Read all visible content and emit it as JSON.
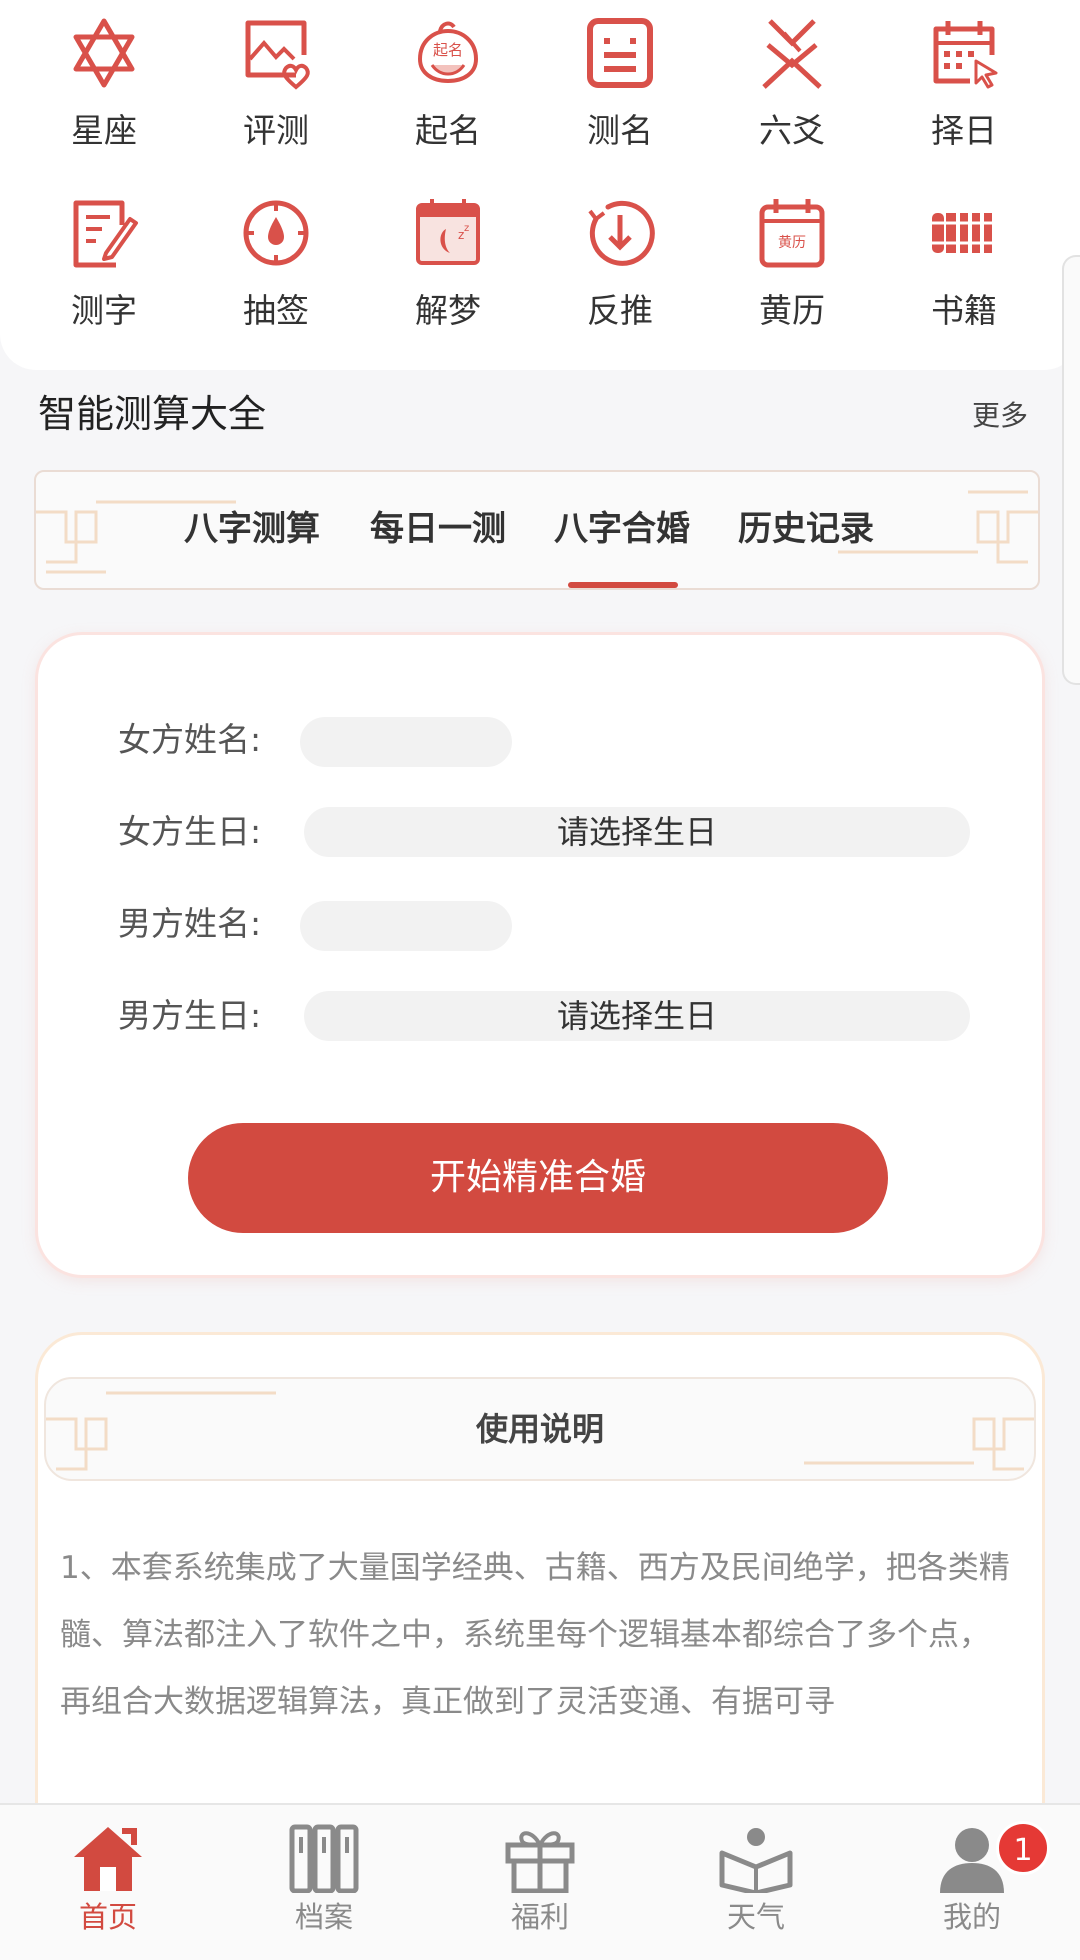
{
  "grid": [
    {
      "label": "星座",
      "icon": "star-of-david-icon"
    },
    {
      "label": "评测",
      "icon": "image-heart-icon"
    },
    {
      "label": "起名",
      "icon": "baby-naming-icon",
      "icon_text": "起名"
    },
    {
      "label": "测名",
      "icon": "document-icon"
    },
    {
      "label": "六爻",
      "icon": "hexagram-icon"
    },
    {
      "label": "择日",
      "icon": "calendar-pointer-icon"
    },
    {
      "label": "测字",
      "icon": "writing-icon"
    },
    {
      "label": "抽签",
      "icon": "compass-icon"
    },
    {
      "label": "解梦",
      "icon": "dream-calendar-icon"
    },
    {
      "label": "反推",
      "icon": "circle-down-arrow-icon"
    },
    {
      "label": "黄历",
      "icon": "almanac-calendar-icon",
      "icon_text": "黄历"
    },
    {
      "label": "书籍",
      "icon": "bamboo-scroll-icon"
    }
  ],
  "section": {
    "title": "智能测算大全",
    "more": "更多"
  },
  "tabs": [
    {
      "label": "八字测算",
      "active": false
    },
    {
      "label": "每日一测",
      "active": false
    },
    {
      "label": "八字合婚",
      "active": true
    },
    {
      "label": "历史记录",
      "active": false
    }
  ],
  "form": {
    "female_name_label": "女方姓名:",
    "female_birth_label": "女方生日:",
    "female_birth_placeholder": "请选择生日",
    "male_name_label": "男方姓名:",
    "male_birth_label": "男方生日:",
    "male_birth_placeholder": "请选择生日",
    "submit_label": "开始精准合婚"
  },
  "info": {
    "title": "使用说明",
    "text": "1、本套系统集成了大量国学经典、古籍、西方及民间绝学，把各类精髓、算法都注入了软件之中，系统里每个逻辑基本都综合了多个点，再组合大数据逻辑算法，真正做到了灵活变通、有据可寻"
  },
  "nav": [
    {
      "label": "首页",
      "icon": "home-icon",
      "active": true
    },
    {
      "label": "档案",
      "icon": "archive-binders-icon",
      "active": false
    },
    {
      "label": "福利",
      "icon": "gift-icon",
      "active": false
    },
    {
      "label": "天气",
      "icon": "book-reader-icon",
      "active": false
    },
    {
      "label": "我的",
      "icon": "user-icon",
      "active": false,
      "badge": "1"
    }
  ],
  "colors": {
    "accent": "#d24a40",
    "icon": "#d9514a",
    "nav_inactive": "#8a8a8a"
  }
}
